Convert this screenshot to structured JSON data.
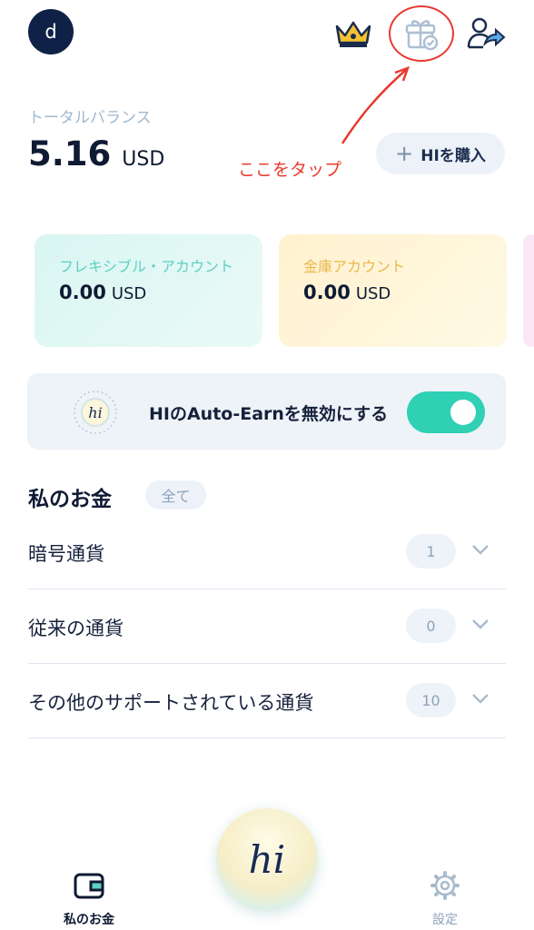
{
  "header": {
    "avatar_letter": "d",
    "icons": [
      "crown-icon",
      "gift-check-icon",
      "share-exit-icon"
    ]
  },
  "balance": {
    "label": "トータルバランス",
    "value": "5.16",
    "unit": "USD",
    "buy_button": "HIを購入"
  },
  "annotation": {
    "text": "ここをタップ",
    "color": "#e83b2f"
  },
  "accounts": [
    {
      "title": "フレキシブル・アカウント",
      "value": "0.00",
      "unit": "USD"
    },
    {
      "title": "金庫アカウント",
      "value": "0.00",
      "unit": "USD"
    }
  ],
  "autoearn": {
    "label": "HIのAuto-Earnを無効にする",
    "enabled": true
  },
  "my_money": {
    "title": "私のお金",
    "filter": "全て",
    "rows": [
      {
        "label": "暗号通貨",
        "count": "1"
      },
      {
        "label": "従来の通貨",
        "count": "0"
      },
      {
        "label": "その他のサポートされている通貨",
        "count": "10"
      }
    ]
  },
  "tabbar": {
    "money_label": "私のお金",
    "center_label": "hi",
    "settings_label": "設定"
  },
  "colors": {
    "accent_toggle": "#30d0b5",
    "navy": "#0f2147"
  }
}
